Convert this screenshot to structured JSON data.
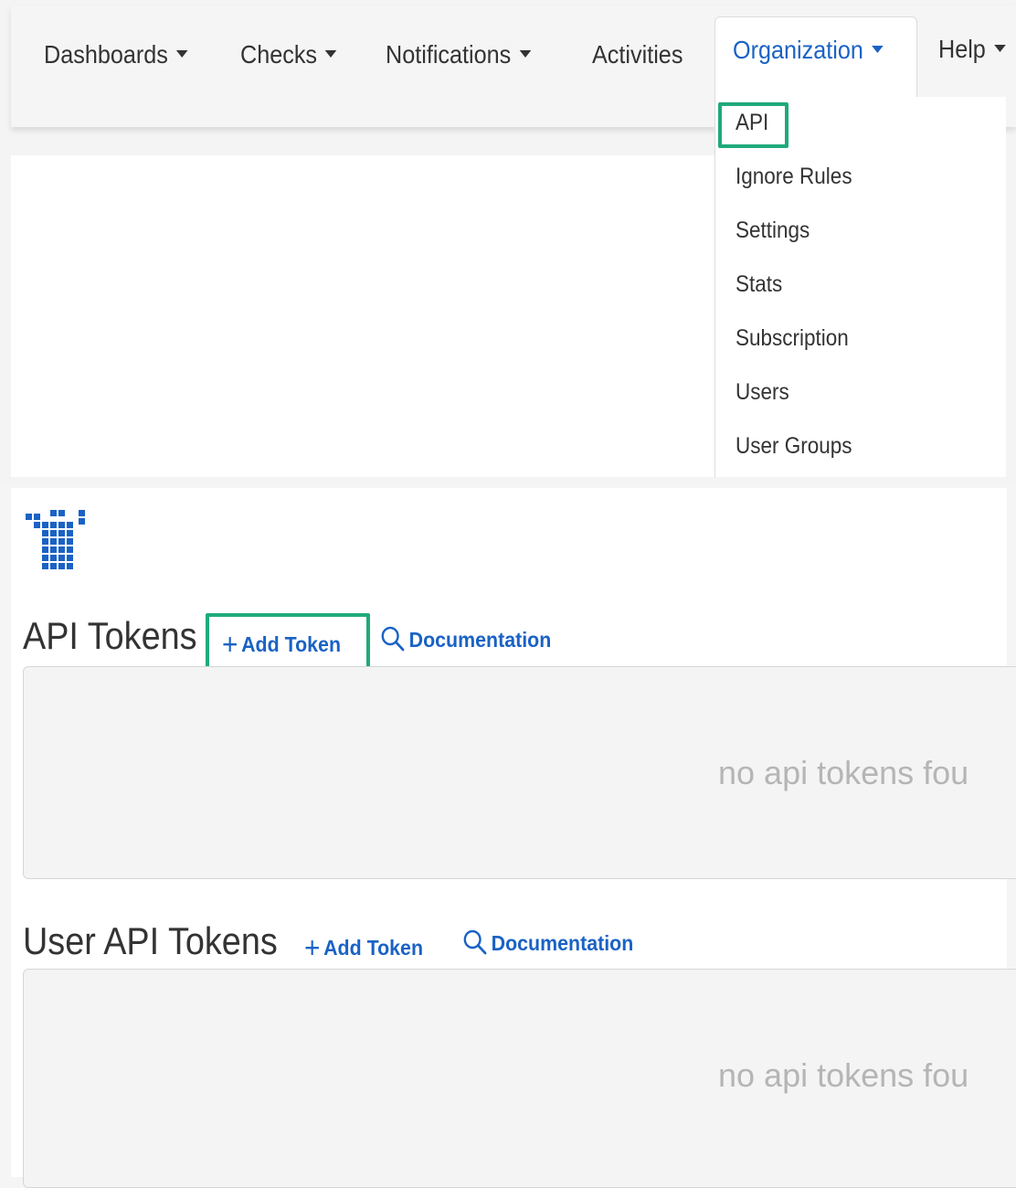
{
  "navbar": {
    "items": [
      {
        "label": "Dashboards",
        "dropdown": true
      },
      {
        "label": "Checks",
        "dropdown": true
      },
      {
        "label": "Notifications",
        "dropdown": true
      },
      {
        "label": "Activities",
        "dropdown": false
      },
      {
        "label": "Organization",
        "dropdown": true,
        "active": true
      },
      {
        "label": "Help",
        "dropdown": true
      }
    ]
  },
  "organization_menu": {
    "items": [
      "API",
      "Ignore Rules",
      "Settings",
      "Stats",
      "Subscription",
      "Users",
      "User Groups"
    ],
    "highlighted": "API"
  },
  "sections": [
    {
      "title": "API Tokens",
      "add_label": "Add Token",
      "doc_label": "Documentation",
      "empty_text": "no api tokens fou",
      "add_highlighted": true
    },
    {
      "title": "User API Tokens",
      "add_label": "Add Token",
      "doc_label": "Documentation",
      "empty_text": "no api tokens fou",
      "add_highlighted": false
    }
  ],
  "colors": {
    "link": "#1a62c5",
    "highlight": "#1faa7c",
    "logo": "#1a62c5"
  }
}
